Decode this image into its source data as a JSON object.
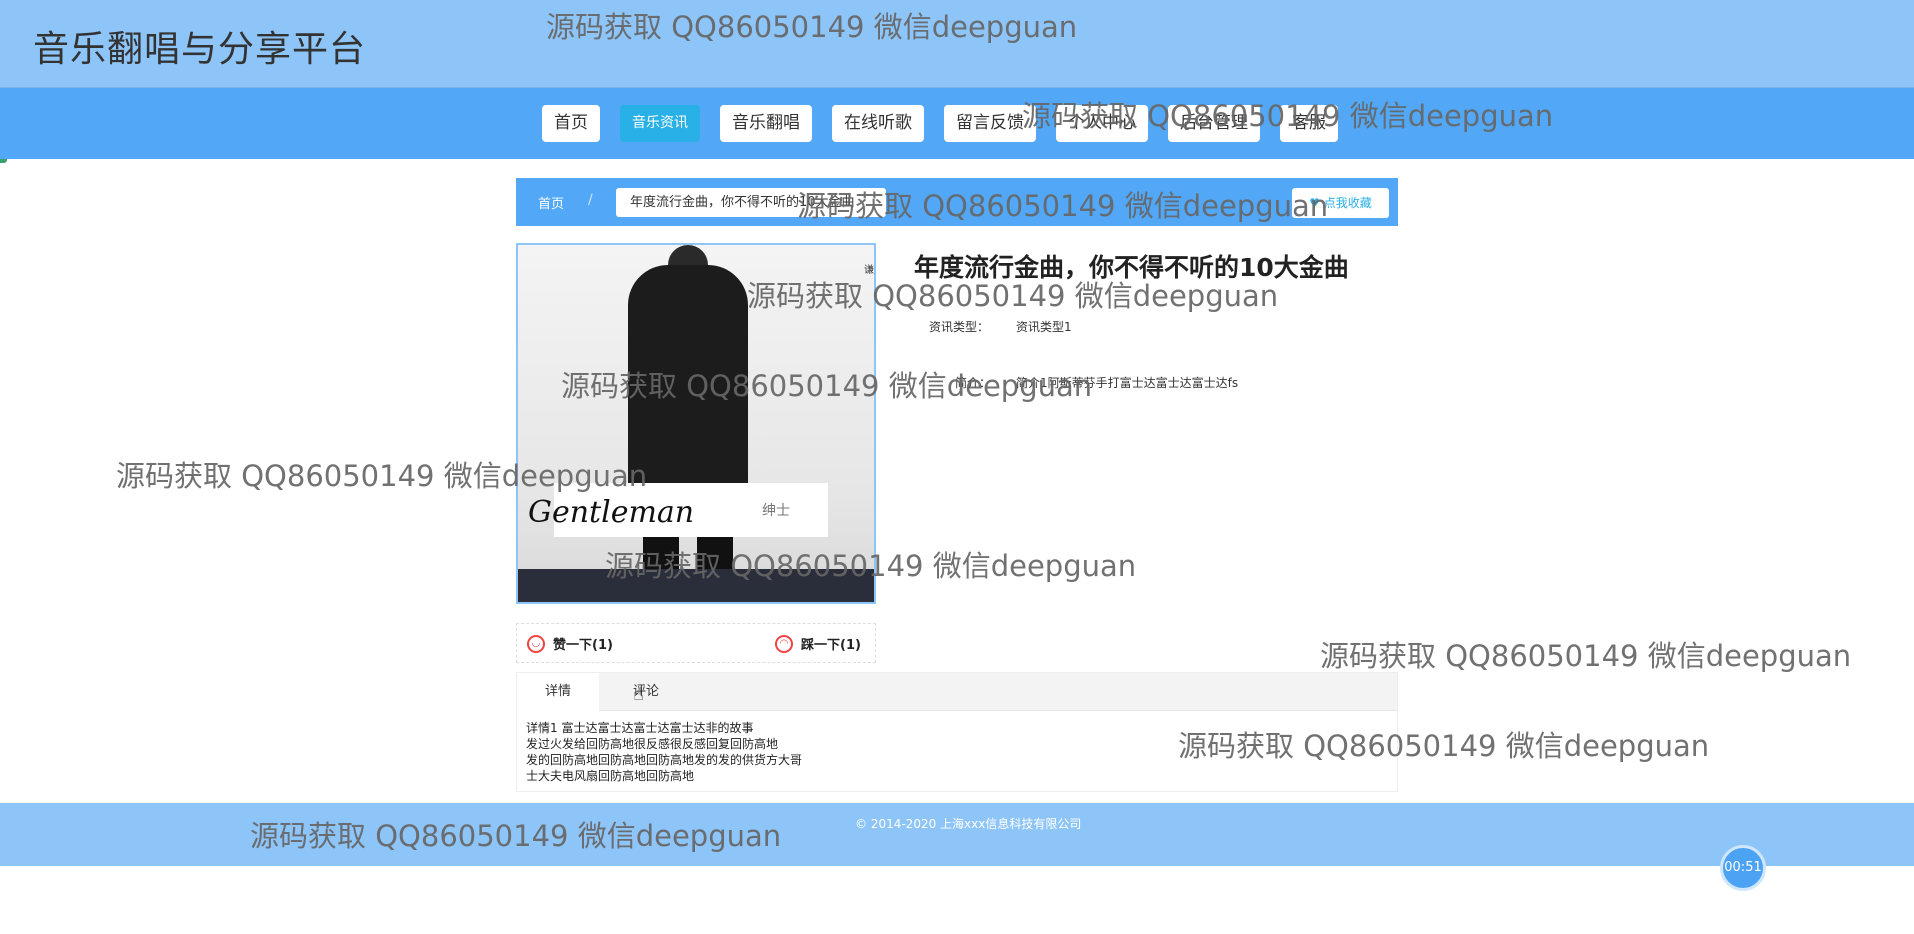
{
  "site": {
    "title": "音乐翻唱与分享平台"
  },
  "nav": {
    "items": [
      {
        "label": "首页"
      },
      {
        "label": "音乐资讯"
      },
      {
        "label": "音乐翻唱"
      },
      {
        "label": "在线听歌"
      },
      {
        "label": "留言反馈"
      },
      {
        "label": "个人中心"
      },
      {
        "label": "后台管理"
      },
      {
        "label": "客服"
      }
    ],
    "active_index": 1
  },
  "breadcrumb": {
    "home": "首页",
    "separator": "/",
    "current": "年度流行金曲，你不得不听的10大金曲",
    "favorite_label": "点我收藏"
  },
  "cover": {
    "signature": "Gentleman",
    "small_text": "绅士",
    "corner_mark": "谦"
  },
  "detail": {
    "title": "年度流行金曲，你不得不听的10大金曲",
    "type_label": "资讯类型：",
    "type_value": "资讯类型1",
    "intro_label": "简介：",
    "intro_value": "简介1阿斯蒂芬手打富士达富士达富士达fs"
  },
  "votes": {
    "like_label": "赞一下(1)",
    "dislike_label": "踩一下(1)"
  },
  "tabs": {
    "items": [
      {
        "label": "详情"
      },
      {
        "label": "评论"
      }
    ],
    "content_lines": [
      "详情1 富士达富士达富士达富士达非的故事",
      "发过火发给回防高地很反感很反感回复回防高地",
      "发的回防高地回防高地回防高地发的发的供货方大哥",
      "士大夫电风扇回防高地回防高地"
    ]
  },
  "footer": {
    "copyright": "© 2014-2020 上海xxx信息科技有限公司"
  },
  "timer": {
    "value": "00:51"
  },
  "watermark": {
    "text": "源码获取 QQ86050149 微信deepguan"
  },
  "colors": {
    "topbar": "#8ec5f9",
    "navbar": "#52a8f7",
    "active_nav": "#29b0e6",
    "footer": "#8ec5f9"
  }
}
